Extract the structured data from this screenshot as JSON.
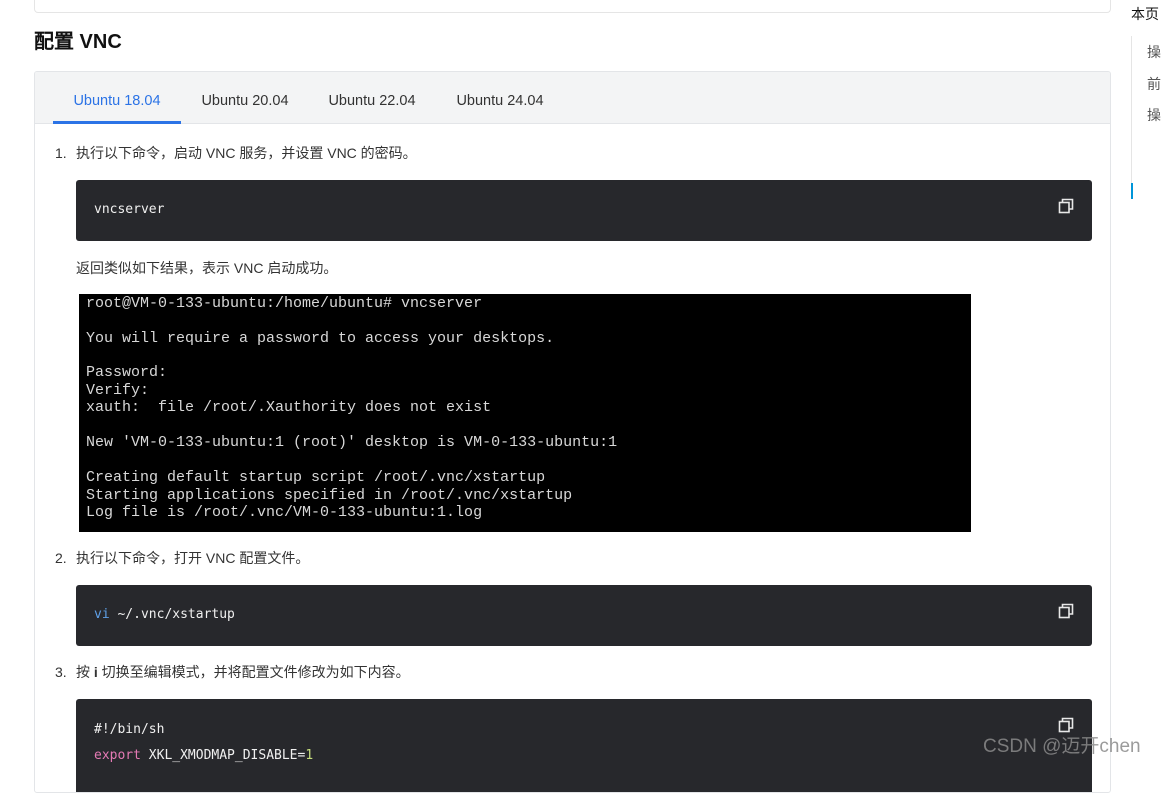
{
  "section": {
    "title": "配置 VNC"
  },
  "tabs": [
    {
      "label": "Ubuntu 18.04",
      "active": true
    },
    {
      "label": "Ubuntu 20.04",
      "active": false
    },
    {
      "label": "Ubuntu 22.04",
      "active": false
    },
    {
      "label": "Ubuntu 24.04",
      "active": false
    }
  ],
  "steps": [
    {
      "num": "1.",
      "text": "执行以下命令，启动 VNC 服务，并设置 VNC 的密码。"
    },
    {
      "num": "2.",
      "text": "执行以下命令，打开 VNC 配置文件。"
    },
    {
      "num": "3.",
      "text_before": "按 ",
      "key": "i",
      "text_after": " 切换至编辑模式，并将配置文件修改为如下内容。"
    }
  ],
  "code1": {
    "line": "vncserver"
  },
  "result_text": "返回类似如下结果，表示 VNC 启动成功。",
  "terminal": {
    "lines": [
      "root@VM-0-133-ubuntu:/home/ubuntu# vncserver",
      "",
      "You will require a password to access your desktops.",
      "",
      "Password:",
      "Verify:",
      "xauth:  file /root/.Xauthority does not exist",
      "",
      "New 'VM-0-133-ubuntu:1 (root)' desktop is VM-0-133-ubuntu:1",
      "",
      "Creating default startup script /root/.vnc/xstartup",
      "Starting applications specified in /root/.vnc/xstartup",
      "Log file is /root/.vnc/VM-0-133-ubuntu:1.log"
    ]
  },
  "code2": {
    "cmd": "vi",
    "arg": " ~/.vnc/xstartup"
  },
  "code3": {
    "shebang": "#!/bin/sh",
    "export_kw": "export",
    "var": " XKL_XMODMAP_DISABLE",
    "eq": "=",
    "val": "1"
  },
  "toc": {
    "header": "本页",
    "items": [
      "操",
      "前",
      "操"
    ]
  },
  "watermark": "CSDN @迈开chen",
  "colors": {
    "accent": "#2b73e6",
    "code_bg": "#27282c",
    "terminal_bg": "#000000"
  }
}
